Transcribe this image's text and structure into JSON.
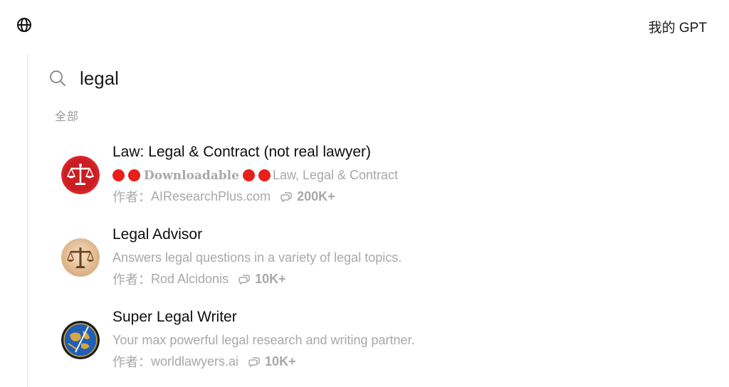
{
  "header": {
    "globe_icon": "globe-icon",
    "my_gpts_label": "我的 GPT"
  },
  "search": {
    "icon": "search-icon",
    "value": "legal"
  },
  "section": {
    "label": "全部"
  },
  "results": [
    {
      "title": "Law: Legal & Contract (not real lawyer)",
      "description_badge": "Downloadable",
      "description": "Law, Legal & Contract",
      "author_prefix": "作者：",
      "author": "AIResearchPlus.com",
      "chats": "200K+",
      "avatar": "scales-of-justice-red-icon"
    },
    {
      "title": "Legal Advisor",
      "description": "Answers legal questions in a variety of legal topics.",
      "author_prefix": "作者：",
      "author": "Rod Alcidonis",
      "chats": "10K+",
      "avatar": "scales-of-justice-bronze-icon"
    },
    {
      "title": "Super Legal Writer",
      "description": "Your max powerful legal research and writing partner.",
      "author_prefix": "作者：",
      "author": "worldlawyers.ai",
      "chats": "10K+",
      "avatar": "globe-quill-icon"
    }
  ],
  "colors": {
    "badge_dot": "#e8201b",
    "secondary_text": "#a8a8a8"
  }
}
